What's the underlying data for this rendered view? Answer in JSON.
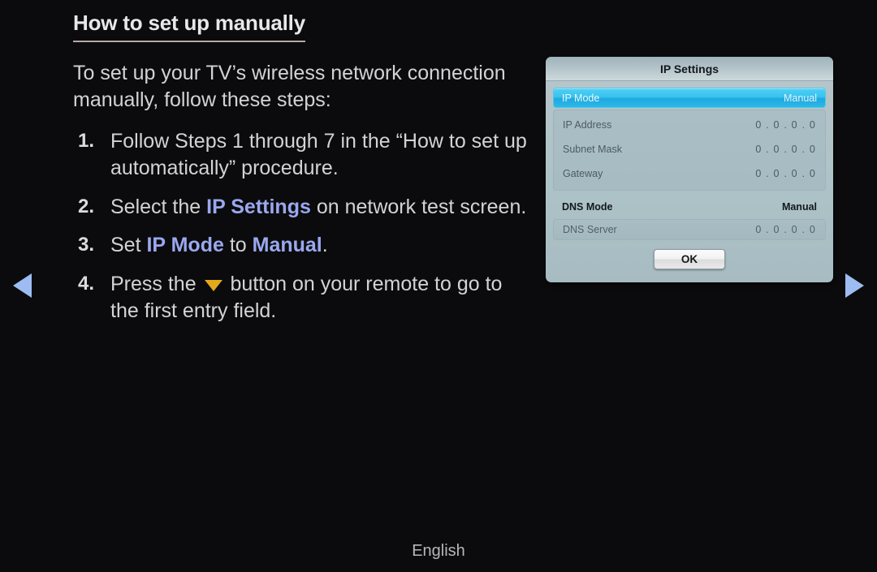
{
  "page": {
    "title": "How to set up manually",
    "intro": "To set up your TV’s wireless network connection manually, follow these steps:",
    "footer_language": "English",
    "background_color": "#0b0b0d",
    "accent_color": "#9aa8ef",
    "arrow_color": "#9dbcf2",
    "down_button_color": "#e3a91b"
  },
  "steps": [
    {
      "number": "1.",
      "parts": [
        {
          "text": "Follow Steps 1 through 7 in the “How to set up automatically” procedure.",
          "style": "normal"
        }
      ]
    },
    {
      "number": "2.",
      "parts": [
        {
          "text": "Select the ",
          "style": "normal"
        },
        {
          "text": "IP Settings",
          "style": "accent"
        },
        {
          "text": " on network test screen.",
          "style": "normal"
        }
      ]
    },
    {
      "number": "3.",
      "parts": [
        {
          "text": "Set ",
          "style": "normal"
        },
        {
          "text": "IP Mode",
          "style": "accent"
        },
        {
          "text": " to ",
          "style": "normal"
        },
        {
          "text": "Manual",
          "style": "accent"
        },
        {
          "text": ".",
          "style": "normal"
        }
      ]
    },
    {
      "number": "4.",
      "parts": [
        {
          "text": "Press the ",
          "style": "normal"
        },
        {
          "text": "",
          "style": "down-icon"
        },
        {
          "text": " button on your remote to go to the first entry field.",
          "style": "normal"
        }
      ]
    }
  ],
  "nav": {
    "prev_label": "previous-page",
    "next_label": "next-page",
    "prev_icon": "triangle-left-icon",
    "next_icon": "triangle-right-icon"
  },
  "dialog": {
    "title": "IP Settings",
    "selected_row": {
      "label": "IP Mode",
      "value": "Manual",
      "highlight_color": "#39c3ee"
    },
    "ip_rows": [
      {
        "label": "IP Address",
        "value": "0 . 0 . 0 . 0"
      },
      {
        "label": "Subnet Mask",
        "value": "0 . 0 . 0 . 0"
      },
      {
        "label": "Gateway",
        "value": "0 . 0 . 0 . 0"
      }
    ],
    "dns_mode": {
      "label": "DNS Mode",
      "value": "Manual"
    },
    "dns_server": {
      "label": "DNS Server",
      "value": "0 . 0 . 0 . 0"
    },
    "ok_button": "OK"
  }
}
